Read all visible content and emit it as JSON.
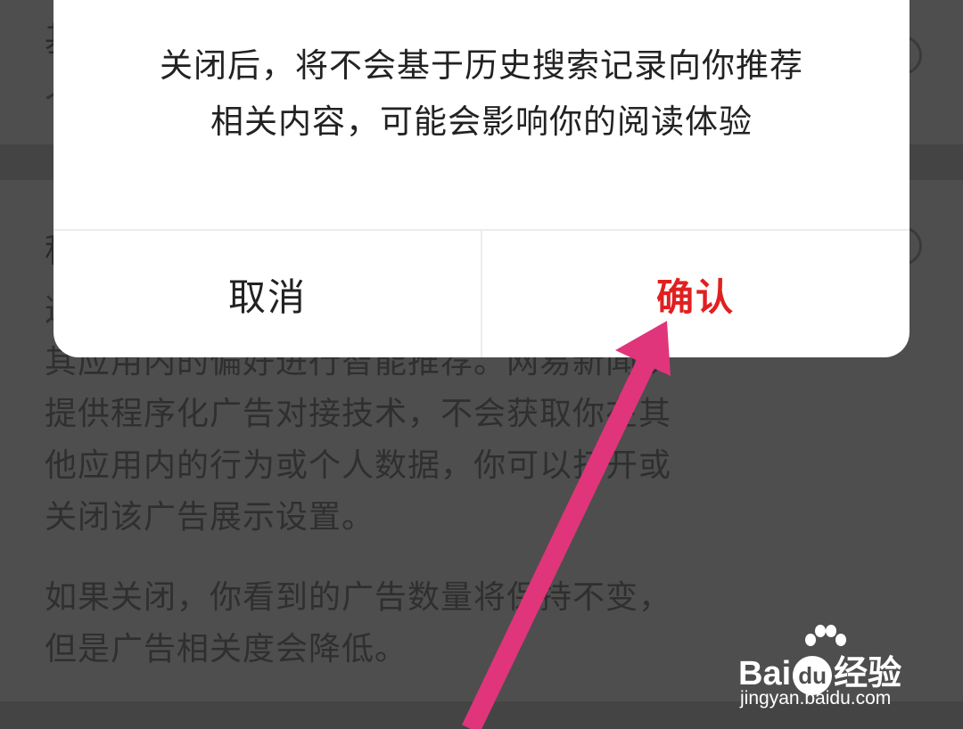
{
  "background": {
    "section1_title_fragment": "基",
    "section1_sub_fragment": "个",
    "section2_title_fragment": "程",
    "section2_lines": [
      "这",
      "其应用内的偏好进行智能推荐。网易新闻仅",
      "提供程序化广告对接技术，不会获取你在其",
      "他应用内的行为或个人数据，你可以打开或",
      "关闭该广告展示设置。"
    ],
    "section2_note_lines": [
      "如果关闭，你看到的广告数量将保持不变，",
      "但是广告相关度会降低。"
    ]
  },
  "dialog": {
    "message_line1": "关闭后，将不会基于历史搜索记录向你推荐",
    "message_line2": "相关内容，可能会影响你的阅读体验",
    "cancel_label": "取消",
    "confirm_label": "确认"
  },
  "watermark": {
    "logo_prefix": "Bai",
    "logo_du": "du",
    "logo_suffix": "经验",
    "url": "jingyan.baidu.com"
  },
  "colors": {
    "confirm": "#e02020",
    "overlay": "#4e4e4e",
    "arrow": "#e0357a"
  },
  "icons": {
    "arrow": "annotation-arrow-icon",
    "paw": "baidu-paw-icon"
  }
}
